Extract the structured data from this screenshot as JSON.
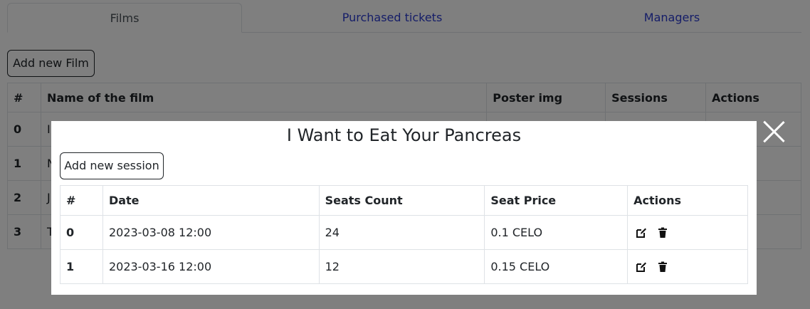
{
  "tabs": [
    {
      "label": "Films",
      "active": true
    },
    {
      "label": "Purchased tickets",
      "active": false
    },
    {
      "label": "Managers",
      "active": false
    }
  ],
  "films": {
    "add_label": "Add new Film",
    "headers": [
      "#",
      "Name of the film",
      "Poster img",
      "Sessions",
      "Actions"
    ],
    "rows": [
      {
        "num": "0",
        "name": "I"
      },
      {
        "num": "1",
        "name": "N"
      },
      {
        "num": "2",
        "name": "J"
      },
      {
        "num": "3",
        "name": "T"
      }
    ]
  },
  "modal": {
    "title": "I Want to Eat Your Pancreas",
    "add_session_label": "Add new session",
    "headers": [
      "#",
      "Date",
      "Seats Count",
      "Seat Price",
      "Actions"
    ],
    "rows": [
      {
        "num": "0",
        "date": "2023-03-08 12:00",
        "seats": "24",
        "price": "0.1 CELO"
      },
      {
        "num": "1",
        "date": "2023-03-16 12:00",
        "seats": "12",
        "price": "0.15 CELO"
      }
    ],
    "icons": {
      "edit": "edit-icon",
      "delete": "trash-icon",
      "close": "close-icon"
    }
  },
  "colors": {
    "link": "#2a3bd0",
    "overlay": "rgba(0,0,0,0.5)"
  }
}
